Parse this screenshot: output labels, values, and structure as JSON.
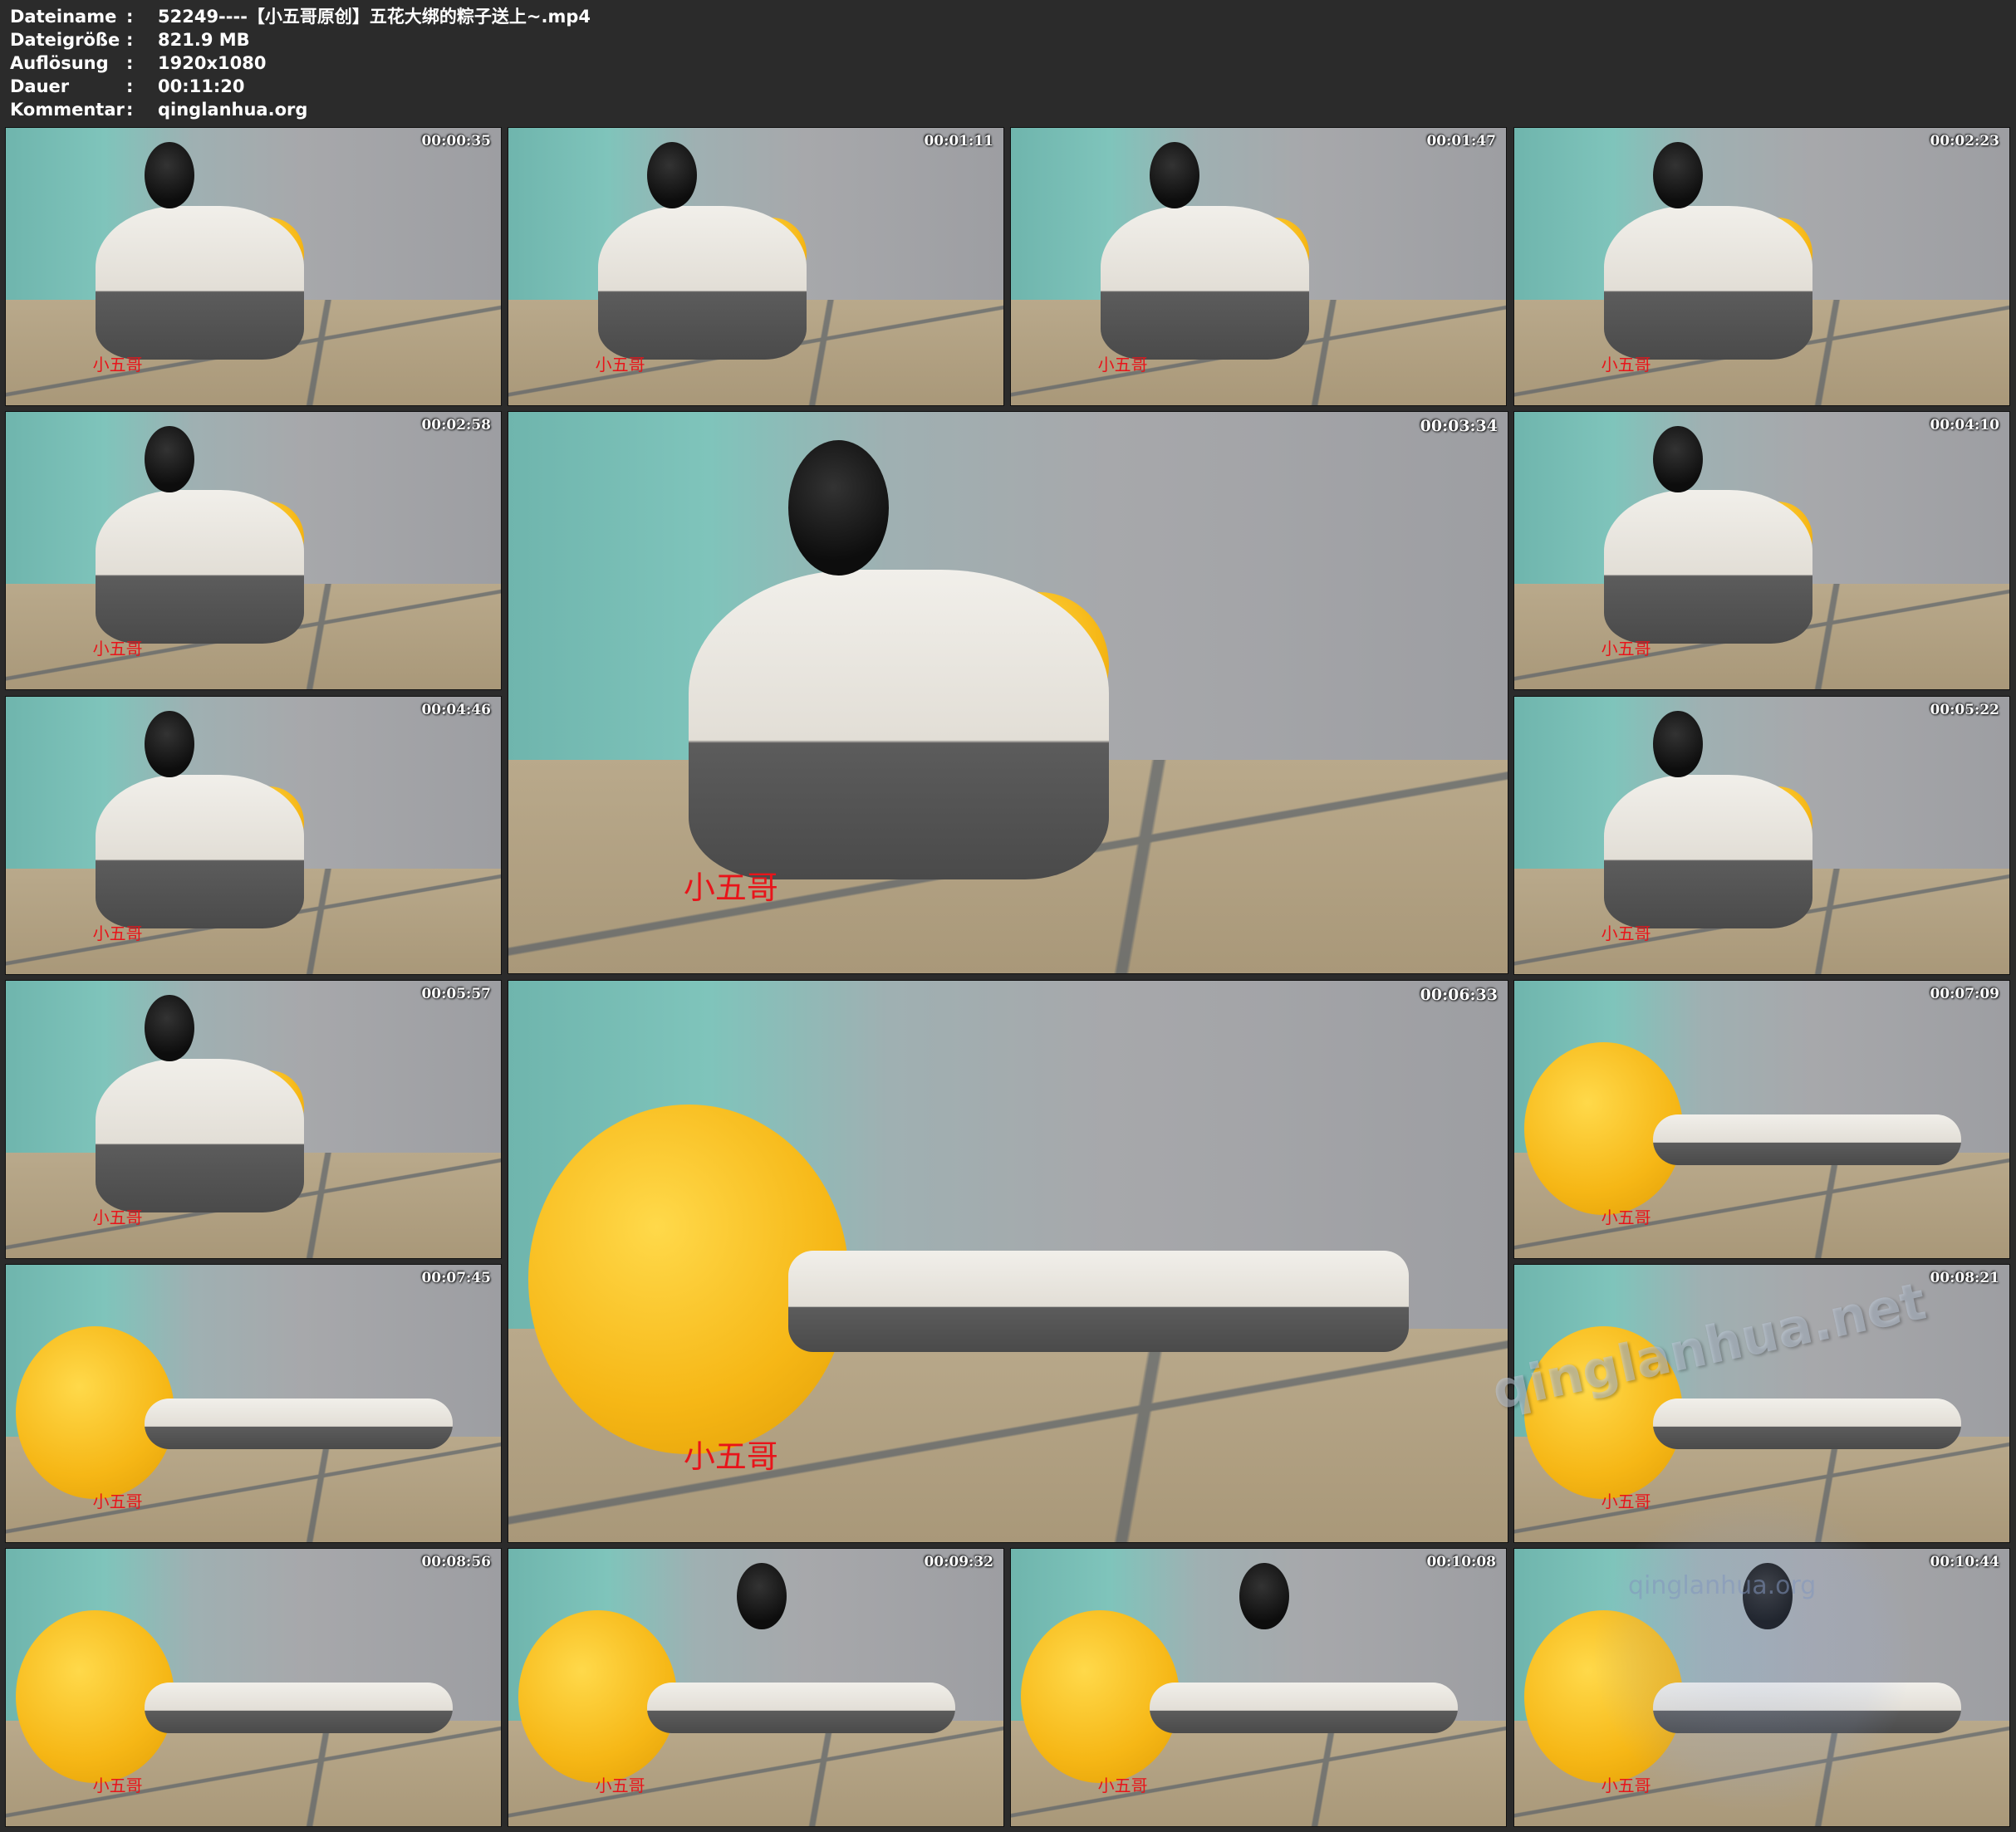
{
  "header": {
    "rows": [
      {
        "key": "Dateiname",
        "sep": ":",
        "value": "52249----【小五哥原创】五花大绑的粽子送上~.mp4"
      },
      {
        "key": "Dateigröße",
        "sep": ":",
        "value": "821.9 MB"
      },
      {
        "key": "Auflösung",
        "sep": ":",
        "value": "1920x1080"
      },
      {
        "key": "Dauer",
        "sep": ":",
        "value": "00:11:20"
      },
      {
        "key": "Kommentar",
        "sep": ":",
        "value": "qinglanhua.org"
      }
    ]
  },
  "watermark_text": "小五哥",
  "site_watermark": "qinglanhua.net",
  "site_watermark_small": "qinglanhua.org",
  "thumbnails": [
    {
      "timestamp": "00:00:35"
    },
    {
      "timestamp": "00:01:11"
    },
    {
      "timestamp": "00:01:47"
    },
    {
      "timestamp": "00:02:23"
    },
    {
      "timestamp": "00:02:58"
    },
    {
      "timestamp": "00:03:34"
    },
    {
      "timestamp": "00:04:10"
    },
    {
      "timestamp": "00:04:46"
    },
    {
      "timestamp": "00:05:22"
    },
    {
      "timestamp": "00:05:57"
    },
    {
      "timestamp": "00:06:33"
    },
    {
      "timestamp": "00:07:09"
    },
    {
      "timestamp": "00:07:45"
    },
    {
      "timestamp": "00:08:21"
    },
    {
      "timestamp": "00:08:56"
    },
    {
      "timestamp": "00:09:32"
    },
    {
      "timestamp": "00:10:08"
    },
    {
      "timestamp": "00:10:44"
    }
  ]
}
